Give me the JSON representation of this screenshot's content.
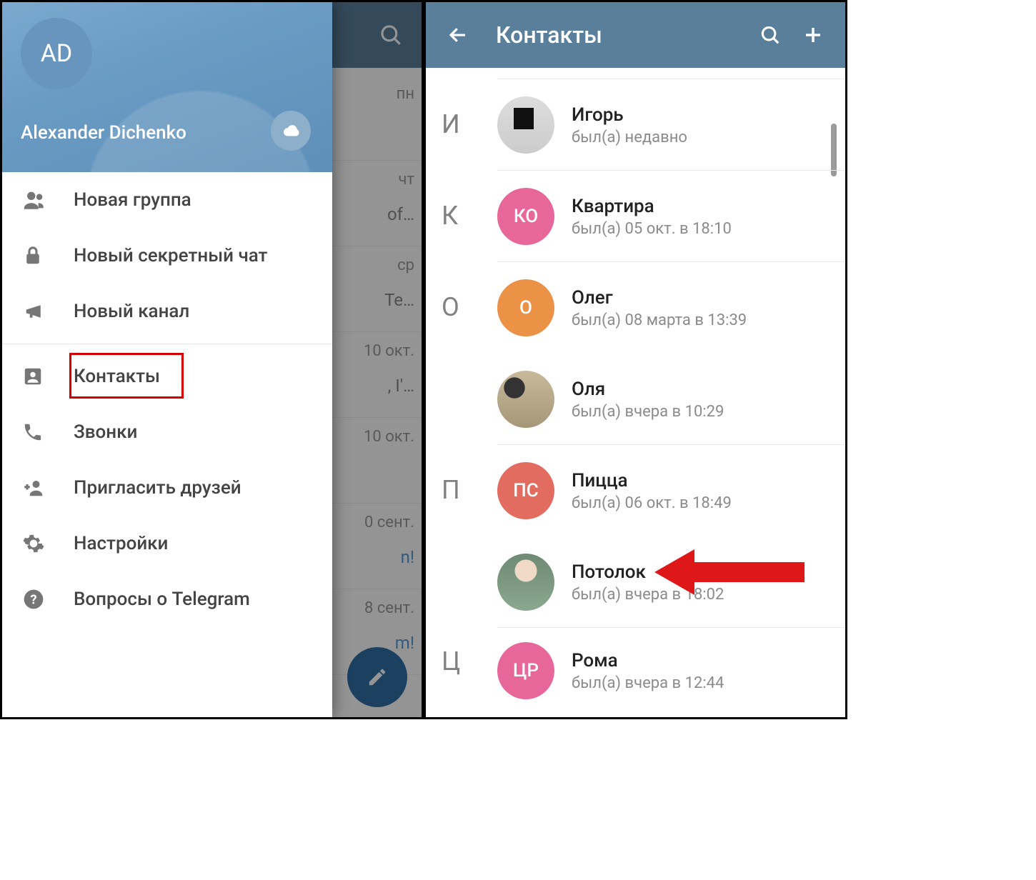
{
  "left": {
    "avatar_initials": "AD",
    "username": "Alexander Dichenko",
    "menu": {
      "new_group": "Новая группа",
      "secret_chat": "Новый секретный чат",
      "new_channel": "Новый канал",
      "contacts": "Контакты",
      "calls": "Звонки",
      "invite_friends": "Пригласить друзей",
      "settings": "Настройки",
      "faq": "Вопросы о Telegram"
    },
    "chat_preview": [
      {
        "date": "пн",
        "snippet": ""
      },
      {
        "date": "чт",
        "snippet": "of…"
      },
      {
        "date": "ср",
        "snippet": "Te…"
      },
      {
        "date": "10 окт.",
        "snippet": ", I'…"
      },
      {
        "date": "10 окт.",
        "snippet": ""
      },
      {
        "date": "0 сент.",
        "snippet": "n!"
      },
      {
        "date": "8 сент.",
        "snippet": "m!"
      }
    ]
  },
  "right": {
    "title": "Контакты",
    "sections": [
      {
        "letter": "И",
        "items": [
          {
            "name": "Игорь",
            "status": "был(а) недавно",
            "avatar_type": "photo",
            "avatar_bg": "#ddd"
          }
        ]
      },
      {
        "letter": "К",
        "items": [
          {
            "name": "Квартира",
            "status": "был(а) 05 окт. в 18:10",
            "avatar_type": "initials",
            "initials": "КО",
            "avatar_bg": "#e8679b"
          }
        ]
      },
      {
        "letter": "О",
        "items": [
          {
            "name": "Олег",
            "status": "был(а) 08 марта в 13:39",
            "avatar_type": "initials",
            "initials": "О",
            "avatar_bg": "#ec9247"
          },
          {
            "name": "Оля",
            "status": "был(а) вчера в 10:29",
            "avatar_type": "photo",
            "avatar_bg": "#bfb398"
          }
        ]
      },
      {
        "letter": "П",
        "items": [
          {
            "name": "Пицца",
            "status": "был(а) 06 окт. в 18:49",
            "avatar_type": "initials",
            "initials": "ПС",
            "avatar_bg": "#e36c61"
          },
          {
            "name": "Потолок",
            "status": "был(а) вчера в 18:02",
            "avatar_type": "photo",
            "avatar_bg": "#8da096"
          }
        ]
      },
      {
        "letter": "Ц",
        "items": [
          {
            "name": "Рома",
            "status": "был(а) вчера в 12:44",
            "avatar_type": "initials",
            "initials": "ЦР",
            "avatar_bg": "#e8679b"
          }
        ]
      }
    ]
  }
}
